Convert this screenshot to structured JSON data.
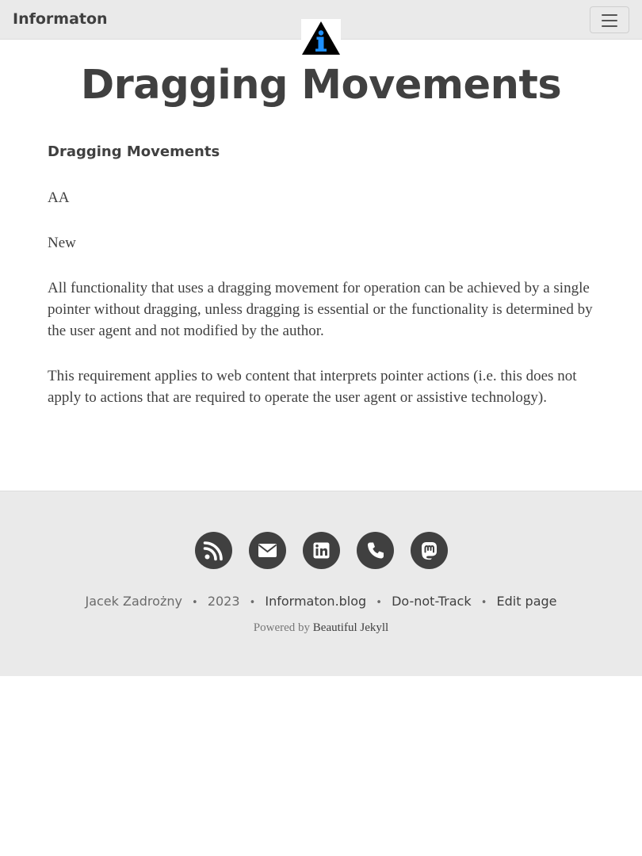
{
  "navbar": {
    "brand": "Informaton",
    "logo_icon": "information-triangle-icon",
    "menu_icon": "hamburger-menu-icon",
    "colors": {
      "background": "#eaeaea",
      "logo_blue": "#1e90ff",
      "logo_dark": "#000000"
    }
  },
  "page": {
    "title": "Dragging Movements",
    "heading": "Dragging Movements",
    "level": "AA",
    "status": "New",
    "paragraphs": [
      "All functionality that uses a dragging movement for operation can be achieved by a single pointer without dragging, unless dragging is essential or the functionality is determined by the user agent and not modified by the author.",
      "This requirement applies to web content that interprets pointer actions (i.e. this does not apply to actions that are required to operate the user agent or assistive technology)."
    ]
  },
  "footer": {
    "social": [
      "rss-icon",
      "envelope-icon",
      "linkedin-icon",
      "phone-icon",
      "mastodon-icon"
    ],
    "author": "Jacek Zadrożny",
    "year": "2023",
    "separator": "•",
    "links": [
      "Informaton.blog",
      "Do-not-Track",
      "Edit page"
    ],
    "powered_by_prefix": "Powered by",
    "powered_by_link": "Beautiful Jekyll",
    "colors": {
      "background": "#eaeaea",
      "icon_circle": "#404040",
      "text": "#404040"
    }
  }
}
